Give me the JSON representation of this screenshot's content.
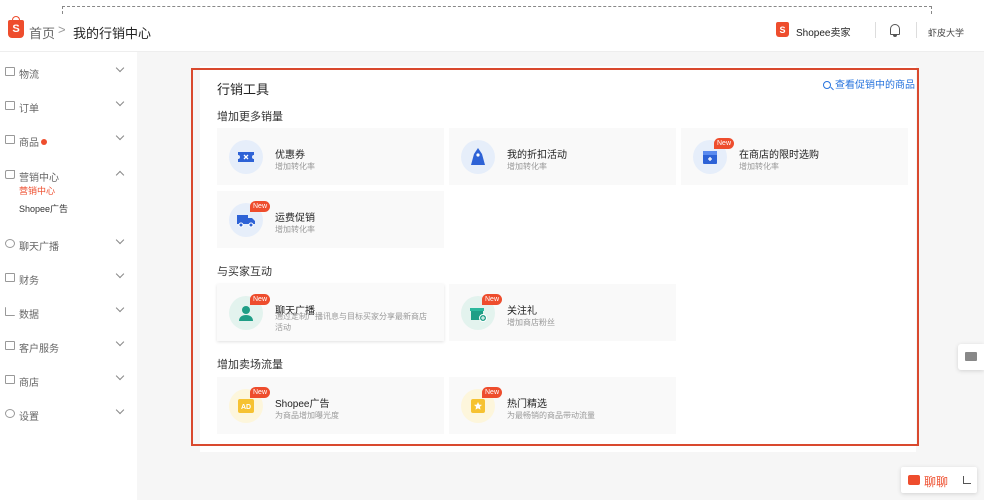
{
  "header": {
    "logo_letter": "S",
    "breadcrumb_home": "首页",
    "breadcrumb_sep": ">",
    "breadcrumb_current": "我的行销中心",
    "seller_logo_letter": "S",
    "seller_label": "Shopee卖家",
    "university": "虾皮大学"
  },
  "sidebar": {
    "items": [
      {
        "label": "物流",
        "icon": "truck-icon"
      },
      {
        "label": "订单",
        "icon": "order-icon"
      },
      {
        "label": "商品",
        "icon": "product-icon"
      },
      {
        "label": "营销中心",
        "icon": "tag-icon"
      },
      {
        "label": "聊天广播",
        "icon": "broadcast-icon"
      },
      {
        "label": "财务",
        "icon": "wallet-icon"
      },
      {
        "label": "数据",
        "icon": "chart-icon"
      },
      {
        "label": "客户服务",
        "icon": "service-icon"
      },
      {
        "label": "商店",
        "icon": "shop-icon"
      },
      {
        "label": "设置",
        "icon": "gear-icon"
      }
    ],
    "marketing_sub": [
      "营销中心",
      "Shopee广告"
    ]
  },
  "main": {
    "title": "行销工具",
    "view_link": "查看促销中的商品",
    "sections": [
      {
        "title": "增加更多销量",
        "cards": [
          {
            "title": "优惠券",
            "desc": "增加转化率",
            "new": false,
            "icon": "coupon-icon"
          },
          {
            "title": "我的折扣活动",
            "desc": "增加转化率",
            "new": false,
            "icon": "discount-bag-icon"
          },
          {
            "title": "在商店的限时选购",
            "desc": "增加转化率",
            "new": true,
            "icon": "flash-sale-icon"
          },
          {
            "title": "运费促销",
            "desc": "增加转化率",
            "new": true,
            "icon": "shipping-truck-icon"
          }
        ]
      },
      {
        "title": "与买家互动",
        "cards": [
          {
            "title": "聊天广播",
            "desc": "通过定制广播讯息与目标买家分享最新商店活动",
            "new": true,
            "icon": "chat-broadcast-icon"
          },
          {
            "title": "关注礼",
            "desc": "增加商店粉丝",
            "new": true,
            "icon": "follow-gift-icon"
          }
        ]
      },
      {
        "title": "增加卖场流量",
        "cards": [
          {
            "title": "Shopee广告",
            "desc": "为商品增加曝光度",
            "new": true,
            "icon": "ad-icon"
          },
          {
            "title": "热门精选",
            "desc": "为最畅销的商品带动流量",
            "new": true,
            "icon": "top-picks-icon"
          }
        ]
      }
    ],
    "new_tag": "New"
  },
  "chat": {
    "label": "聊聊"
  },
  "colors": {
    "brand": "#ee4d2d",
    "link": "#2673dd",
    "highlight_frame": "#d9492e"
  }
}
